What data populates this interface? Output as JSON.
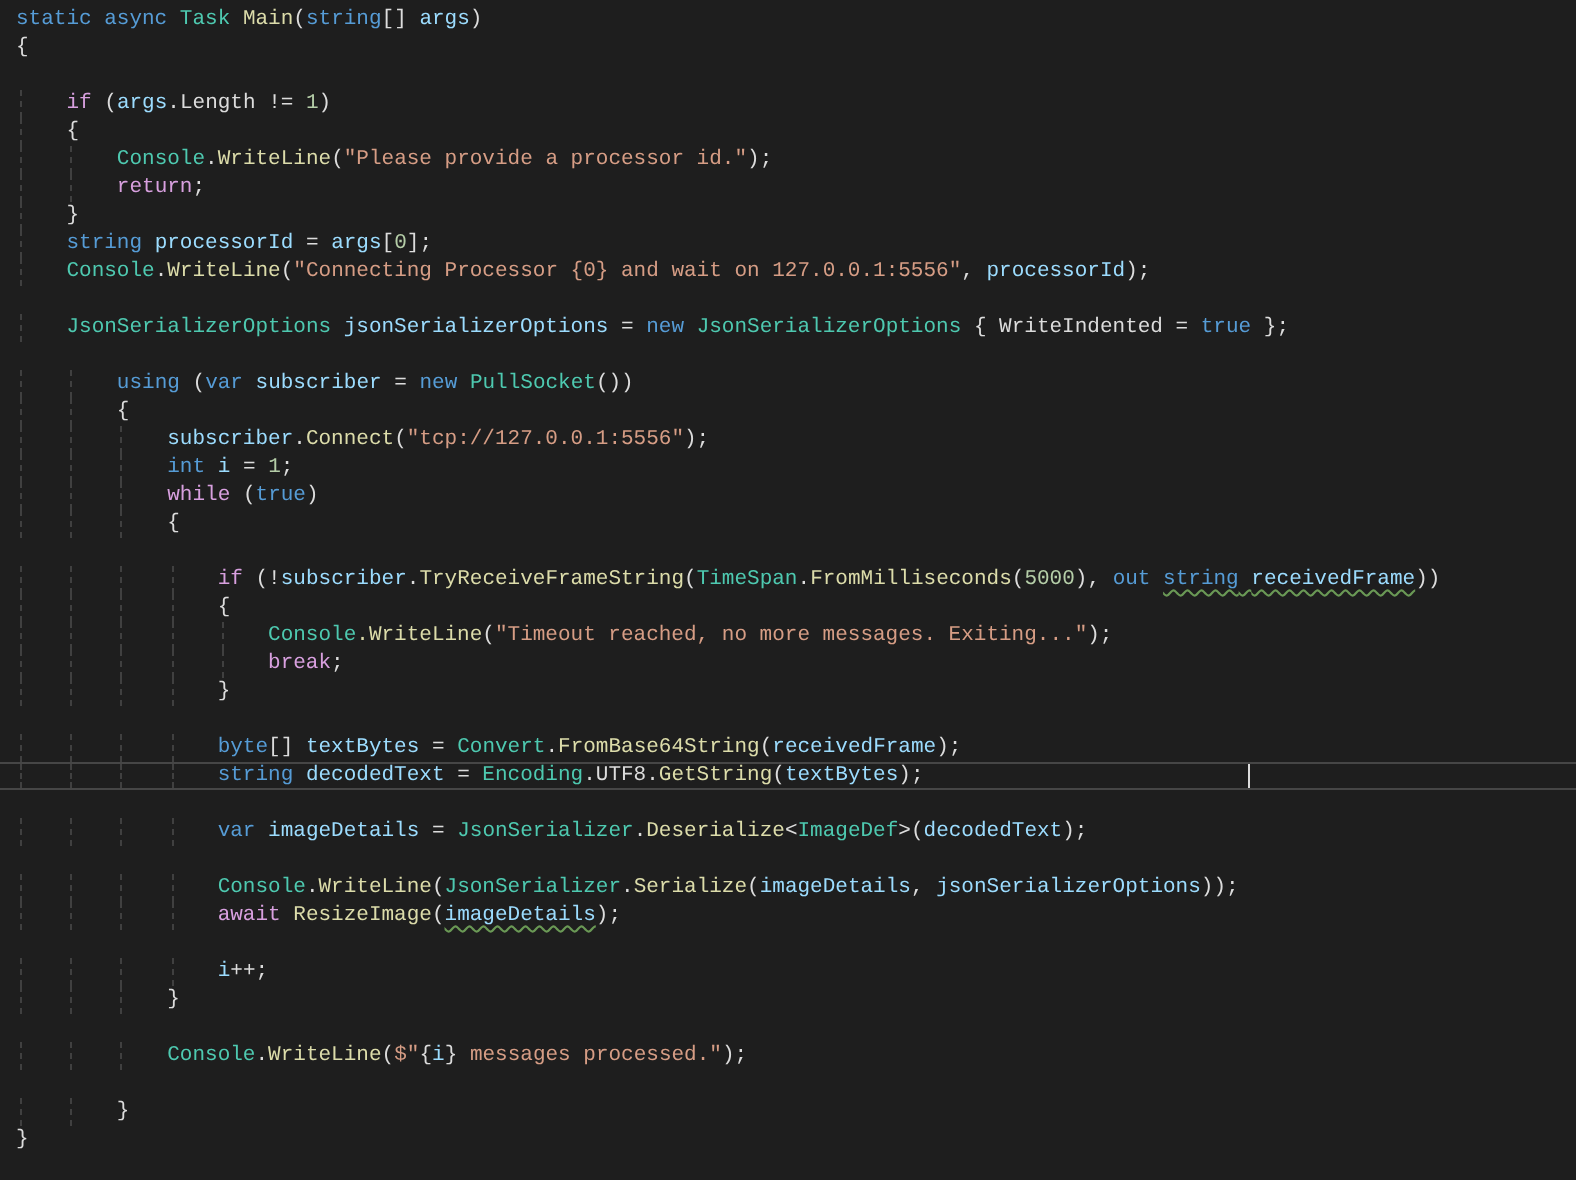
{
  "editor": {
    "lines": [
      {
        "kind": "code",
        "current": false,
        "tokens": [
          {
            "text": "static async ",
            "kind": "keyword"
          },
          {
            "text": "Task ",
            "kind": "type"
          },
          {
            "text": "Main",
            "kind": "method"
          },
          {
            "text": "(",
            "kind": "plain"
          },
          {
            "text": "string",
            "kind": "keyword"
          },
          {
            "text": "[] ",
            "kind": "plain"
          },
          {
            "text": "args",
            "kind": "variable"
          },
          {
            "text": ")",
            "kind": "plain"
          }
        ]
      },
      {
        "kind": "code",
        "current": false,
        "tokens": [
          {
            "text": "{",
            "kind": "plain"
          }
        ]
      },
      {
        "kind": "blank"
      },
      {
        "kind": "code",
        "current": false,
        "tokens": [
          {
            "text": "    if",
            "kind": "control"
          },
          {
            "text": " (",
            "kind": "plain"
          },
          {
            "text": "args",
            "kind": "variable"
          },
          {
            "text": ".Length != ",
            "kind": "plain"
          },
          {
            "text": "1",
            "kind": "number"
          },
          {
            "text": ")",
            "kind": "plain"
          }
        ]
      },
      {
        "kind": "code",
        "current": false,
        "tokens": [
          {
            "text": "    {",
            "kind": "plain"
          }
        ]
      },
      {
        "kind": "code",
        "current": false,
        "tokens": [
          {
            "text": "        Console",
            "kind": "type"
          },
          {
            "text": ".",
            "kind": "plain"
          },
          {
            "text": "WriteLine",
            "kind": "method"
          },
          {
            "text": "(",
            "kind": "plain"
          },
          {
            "text": "\"Please provide a processor id.\"",
            "kind": "string"
          },
          {
            "text": ");",
            "kind": "plain"
          }
        ]
      },
      {
        "kind": "code",
        "current": false,
        "tokens": [
          {
            "text": "        return",
            "kind": "control"
          },
          {
            "text": ";",
            "kind": "plain"
          }
        ]
      },
      {
        "kind": "code",
        "current": false,
        "tokens": [
          {
            "text": "    }",
            "kind": "plain"
          }
        ]
      },
      {
        "kind": "code",
        "current": false,
        "tokens": [
          {
            "text": "    string ",
            "kind": "keyword"
          },
          {
            "text": "processorId",
            "kind": "variable"
          },
          {
            "text": " = ",
            "kind": "plain"
          },
          {
            "text": "args",
            "kind": "variable"
          },
          {
            "text": "[",
            "kind": "plain"
          },
          {
            "text": "0",
            "kind": "number"
          },
          {
            "text": "];",
            "kind": "plain"
          }
        ]
      },
      {
        "kind": "code",
        "current": false,
        "tokens": [
          {
            "text": "    Console",
            "kind": "type"
          },
          {
            "text": ".",
            "kind": "plain"
          },
          {
            "text": "WriteLine",
            "kind": "method"
          },
          {
            "text": "(",
            "kind": "plain"
          },
          {
            "text": "\"Connecting Processor {0} and wait on 127.0.0.1:5556\"",
            "kind": "string"
          },
          {
            "text": ", ",
            "kind": "plain"
          },
          {
            "text": "processorId",
            "kind": "variable"
          },
          {
            "text": ");",
            "kind": "plain"
          }
        ]
      },
      {
        "kind": "blank"
      },
      {
        "kind": "code",
        "current": false,
        "tokens": [
          {
            "text": "    JsonSerializerOptions ",
            "kind": "type"
          },
          {
            "text": "jsonSerializerOptions",
            "kind": "variable"
          },
          {
            "text": " = ",
            "kind": "plain"
          },
          {
            "text": "new ",
            "kind": "keyword"
          },
          {
            "text": "JsonSerializerOptions",
            "kind": "type"
          },
          {
            "text": " { WriteIndented = ",
            "kind": "plain"
          },
          {
            "text": "true",
            "kind": "keyword"
          },
          {
            "text": " };",
            "kind": "plain"
          }
        ]
      },
      {
        "kind": "blank"
      },
      {
        "kind": "code",
        "current": false,
        "tokens": [
          {
            "text": "        using",
            "kind": "keyword"
          },
          {
            "text": " (",
            "kind": "plain"
          },
          {
            "text": "var ",
            "kind": "keyword"
          },
          {
            "text": "subscriber",
            "kind": "variable"
          },
          {
            "text": " = ",
            "kind": "plain"
          },
          {
            "text": "new ",
            "kind": "keyword"
          },
          {
            "text": "PullSocket",
            "kind": "type"
          },
          {
            "text": "())",
            "kind": "plain"
          }
        ]
      },
      {
        "kind": "code",
        "current": false,
        "tokens": [
          {
            "text": "        {",
            "kind": "plain"
          }
        ]
      },
      {
        "kind": "code",
        "current": false,
        "tokens": [
          {
            "text": "            subscriber",
            "kind": "variable"
          },
          {
            "text": ".",
            "kind": "plain"
          },
          {
            "text": "Connect",
            "kind": "method"
          },
          {
            "text": "(",
            "kind": "plain"
          },
          {
            "text": "\"tcp://127.0.0.1:5556\"",
            "kind": "string"
          },
          {
            "text": ");",
            "kind": "plain"
          }
        ]
      },
      {
        "kind": "code",
        "current": false,
        "tokens": [
          {
            "text": "            int ",
            "kind": "keyword"
          },
          {
            "text": "i",
            "kind": "variable"
          },
          {
            "text": " = ",
            "kind": "plain"
          },
          {
            "text": "1",
            "kind": "number"
          },
          {
            "text": ";",
            "kind": "plain"
          }
        ]
      },
      {
        "kind": "code",
        "current": false,
        "tokens": [
          {
            "text": "            while",
            "kind": "control"
          },
          {
            "text": " (",
            "kind": "plain"
          },
          {
            "text": "true",
            "kind": "keyword"
          },
          {
            "text": ")",
            "kind": "plain"
          }
        ]
      },
      {
        "kind": "code",
        "current": false,
        "tokens": [
          {
            "text": "            {",
            "kind": "plain"
          }
        ]
      },
      {
        "kind": "blank"
      },
      {
        "kind": "code",
        "current": false,
        "tokens": [
          {
            "text": "                if",
            "kind": "control"
          },
          {
            "text": " (!",
            "kind": "plain"
          },
          {
            "text": "subscriber",
            "kind": "variable"
          },
          {
            "text": ".",
            "kind": "plain"
          },
          {
            "text": "TryReceiveFrameString",
            "kind": "method"
          },
          {
            "text": "(",
            "kind": "plain"
          },
          {
            "text": "TimeSpan",
            "kind": "type"
          },
          {
            "text": ".",
            "kind": "plain"
          },
          {
            "text": "FromMilliseconds",
            "kind": "method"
          },
          {
            "text": "(",
            "kind": "plain"
          },
          {
            "text": "5000",
            "kind": "number"
          },
          {
            "text": "), ",
            "kind": "plain"
          },
          {
            "text": "out ",
            "kind": "keyword"
          },
          {
            "text": "string",
            "kind": "keyword",
            "squiggle": true
          },
          {
            "text": " receivedFrame",
            "kind": "variable",
            "squiggle": true
          },
          {
            "text": "))",
            "kind": "plain"
          }
        ]
      },
      {
        "kind": "code",
        "current": false,
        "tokens": [
          {
            "text": "                {",
            "kind": "plain"
          }
        ]
      },
      {
        "kind": "code",
        "current": false,
        "tokens": [
          {
            "text": "                    Console",
            "kind": "type"
          },
          {
            "text": ".WriteLine",
            "kind": "method"
          },
          {
            "text": "(",
            "kind": "plain"
          },
          {
            "text": "\"Timeout reached, no more messages. Exiting...\"",
            "kind": "string"
          },
          {
            "text": ");",
            "kind": "plain"
          }
        ]
      },
      {
        "kind": "code",
        "current": false,
        "tokens": [
          {
            "text": "                    break",
            "kind": "control"
          },
          {
            "text": ";",
            "kind": "plain"
          }
        ]
      },
      {
        "kind": "code",
        "current": false,
        "tokens": [
          {
            "text": "                }",
            "kind": "plain"
          }
        ]
      },
      {
        "kind": "blank"
      },
      {
        "kind": "code",
        "current": false,
        "tokens": [
          {
            "text": "                byte",
            "kind": "keyword"
          },
          {
            "text": "[] ",
            "kind": "plain"
          },
          {
            "text": "textBytes",
            "kind": "variable"
          },
          {
            "text": " = ",
            "kind": "plain"
          },
          {
            "text": "Convert",
            "kind": "type"
          },
          {
            "text": ".",
            "kind": "plain"
          },
          {
            "text": "FromBase64String",
            "kind": "method"
          },
          {
            "text": "(",
            "kind": "plain"
          },
          {
            "text": "receivedFrame",
            "kind": "variable"
          },
          {
            "text": ");",
            "kind": "plain"
          }
        ]
      },
      {
        "kind": "code",
        "current": true,
        "tokens": [
          {
            "text": "                string ",
            "kind": "keyword"
          },
          {
            "text": "decodedText",
            "kind": "variable"
          },
          {
            "text": " = ",
            "kind": "plain"
          },
          {
            "text": "Encoding",
            "kind": "type"
          },
          {
            "text": ".UTF8.",
            "kind": "plain"
          },
          {
            "text": "GetString",
            "kind": "method"
          },
          {
            "text": "(",
            "kind": "plain"
          },
          {
            "text": "textBytes",
            "kind": "variable"
          },
          {
            "text": ");",
            "kind": "plain"
          }
        ]
      },
      {
        "kind": "blank"
      },
      {
        "kind": "code",
        "current": false,
        "tokens": [
          {
            "text": "                var ",
            "kind": "keyword"
          },
          {
            "text": "imageDetails",
            "kind": "variable"
          },
          {
            "text": " = ",
            "kind": "plain"
          },
          {
            "text": "JsonSerializer",
            "kind": "type"
          },
          {
            "text": ".",
            "kind": "plain"
          },
          {
            "text": "Deserialize",
            "kind": "method"
          },
          {
            "text": "<",
            "kind": "plain"
          },
          {
            "text": "ImageDef",
            "kind": "type"
          },
          {
            "text": ">(",
            "kind": "plain"
          },
          {
            "text": "decodedText",
            "kind": "variable"
          },
          {
            "text": ");",
            "kind": "plain"
          }
        ]
      },
      {
        "kind": "blank"
      },
      {
        "kind": "code",
        "current": false,
        "tokens": [
          {
            "text": "                Console",
            "kind": "type"
          },
          {
            "text": ".",
            "kind": "plain"
          },
          {
            "text": "WriteLine",
            "kind": "method"
          },
          {
            "text": "(",
            "kind": "plain"
          },
          {
            "text": "JsonSerializer",
            "kind": "type"
          },
          {
            "text": ".",
            "kind": "plain"
          },
          {
            "text": "Serialize",
            "kind": "method"
          },
          {
            "text": "(",
            "kind": "plain"
          },
          {
            "text": "imageDetails",
            "kind": "variable"
          },
          {
            "text": ", ",
            "kind": "plain"
          },
          {
            "text": "jsonSerializerOptions",
            "kind": "variable"
          },
          {
            "text": "));",
            "kind": "plain"
          }
        ]
      },
      {
        "kind": "code",
        "current": false,
        "tokens": [
          {
            "text": "                await ",
            "kind": "control"
          },
          {
            "text": "ResizeImage",
            "kind": "method"
          },
          {
            "text": "(",
            "kind": "plain"
          },
          {
            "text": "imageDetails",
            "kind": "variable",
            "squiggle": true
          },
          {
            "text": ");",
            "kind": "plain"
          }
        ]
      },
      {
        "kind": "blank"
      },
      {
        "kind": "code",
        "current": false,
        "tokens": [
          {
            "text": "                i",
            "kind": "variable"
          },
          {
            "text": "++;",
            "kind": "plain"
          }
        ]
      },
      {
        "kind": "code",
        "current": false,
        "tokens": [
          {
            "text": "            }",
            "kind": "plain"
          }
        ]
      },
      {
        "kind": "blank"
      },
      {
        "kind": "code",
        "current": false,
        "tokens": [
          {
            "text": "            Console",
            "kind": "type"
          },
          {
            "text": ".",
            "kind": "plain"
          },
          {
            "text": "WriteLine",
            "kind": "method"
          },
          {
            "text": "(",
            "kind": "plain"
          },
          {
            "text": "$\"",
            "kind": "string"
          },
          {
            "text": "{",
            "kind": "plain"
          },
          {
            "text": "i",
            "kind": "variable"
          },
          {
            "text": "}",
            "kind": "plain"
          },
          {
            "text": " messages processed.\"",
            "kind": "string"
          },
          {
            "text": ");",
            "kind": "plain"
          }
        ]
      },
      {
        "kind": "blank"
      },
      {
        "kind": "code",
        "current": false,
        "tokens": [
          {
            "text": "        }",
            "kind": "plain"
          }
        ]
      },
      {
        "kind": "code",
        "current": false,
        "tokens": [
          {
            "text": "}",
            "kind": "plain"
          }
        ]
      }
    ]
  }
}
